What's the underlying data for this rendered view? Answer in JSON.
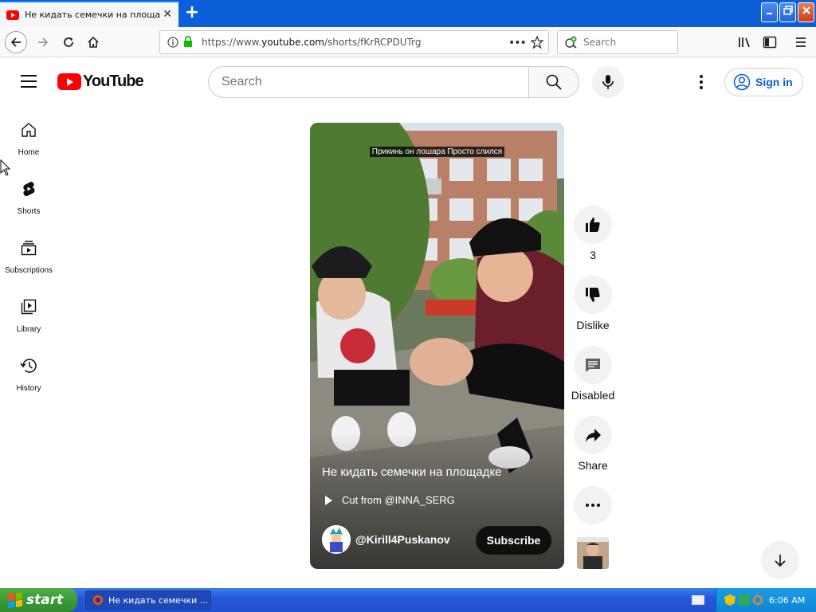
{
  "browser": {
    "tab_title": "Не кидать семечки на площадке",
    "tab_close": "✕",
    "new_tab": "+",
    "url_prefix": "https://www.",
    "url_domain": "youtube.com",
    "url_path": "/shorts/fKrRCPDUTrg",
    "search_placeholder": "Search",
    "window_buttons": {
      "minimize": "_",
      "restore": "❐",
      "close": "✕"
    }
  },
  "youtube": {
    "logo_text": "YouTube",
    "search_placeholder": "Search",
    "sign_in_label": "Sign in"
  },
  "guide": {
    "items": [
      {
        "label": "Home",
        "icon": "home-icon"
      },
      {
        "label": "Shorts",
        "icon": "shorts-icon"
      },
      {
        "label": "Subscriptions",
        "icon": "subscriptions-icon"
      },
      {
        "label": "Library",
        "icon": "library-icon"
      },
      {
        "label": "History",
        "icon": "history-icon"
      }
    ]
  },
  "short": {
    "overlay_caption": "Прикинь он лошара Просто слился",
    "title": "Не кидать семечки на площадке",
    "cut_from": "Cut from @INNA_SERG",
    "channel_name": "@Kirill4Puskanov",
    "subscribe_label": "Subscribe"
  },
  "actions": {
    "like_count": "3",
    "dislike_label": "Dislike",
    "comments_label": "Disabled",
    "share_label": "Share"
  },
  "taskbar": {
    "start_label": "start",
    "task_title": "Не кидать семечки ...",
    "clock": "6:06 AM"
  },
  "colors": {
    "yt_red": "#ff0000",
    "link_blue": "#065fd4",
    "xp_blue": "#2459d9",
    "xp_green": "#3a9a36"
  }
}
